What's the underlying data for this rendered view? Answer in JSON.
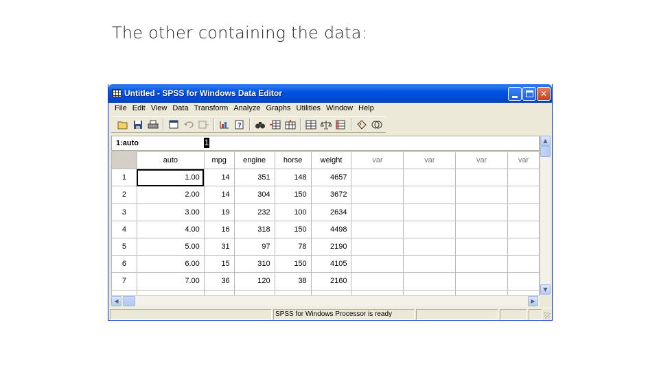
{
  "slide": {
    "title": "The other containing the data:"
  },
  "window": {
    "title": "Untitled - SPSS for Windows Data Editor",
    "controls": {
      "minimize": "_",
      "maximize": "□",
      "close": "✕"
    }
  },
  "menu": [
    "File",
    "Edit",
    "View",
    "Data",
    "Transform",
    "Analyze",
    "Graphs",
    "Utilities",
    "Window",
    "Help"
  ],
  "toolbar": {
    "icons": [
      "open-icon",
      "save-icon",
      "print-icon",
      "dialog-recall-icon",
      "undo-icon",
      "redo-icon",
      "goto-chart-icon",
      "goto-case-icon",
      "variables-icon",
      "find-icon",
      "insert-case-icon",
      "insert-variable-icon",
      "split-file-icon",
      "weight-cases-icon",
      "select-cases-icon",
      "value-labels-icon",
      "use-sets-icon"
    ]
  },
  "cell_editor": {
    "reference": "1:auto",
    "value": "1"
  },
  "grid": {
    "columns": [
      "auto",
      "mpg",
      "engine",
      "horse",
      "weight",
      "var",
      "var",
      "var",
      "var"
    ],
    "rows": [
      {
        "n": "1",
        "auto": "1.00",
        "mpg": "14",
        "engine": "351",
        "horse": "148",
        "weight": "4657"
      },
      {
        "n": "2",
        "auto": "2.00",
        "mpg": "14",
        "engine": "304",
        "horse": "150",
        "weight": "3672"
      },
      {
        "n": "3",
        "auto": "3.00",
        "mpg": "19",
        "engine": "232",
        "horse": "100",
        "weight": "2634"
      },
      {
        "n": "4",
        "auto": "4.00",
        "mpg": "16",
        "engine": "318",
        "horse": "150",
        "weight": "4498"
      },
      {
        "n": "5",
        "auto": "5.00",
        "mpg": "31",
        "engine": "97",
        "horse": "78",
        "weight": "2190"
      },
      {
        "n": "6",
        "auto": "6.00",
        "mpg": "15",
        "engine": "310",
        "horse": "150",
        "weight": "4105"
      },
      {
        "n": "7",
        "auto": "7.00",
        "mpg": "36",
        "engine": "120",
        "horse": "38",
        "weight": "2160"
      }
    ]
  },
  "status": {
    "message": "SPSS for Windows Processor is ready"
  },
  "colors": {
    "titlebar": "#0054e3",
    "chrome": "#ece9d8",
    "accent": "#0831d9"
  }
}
